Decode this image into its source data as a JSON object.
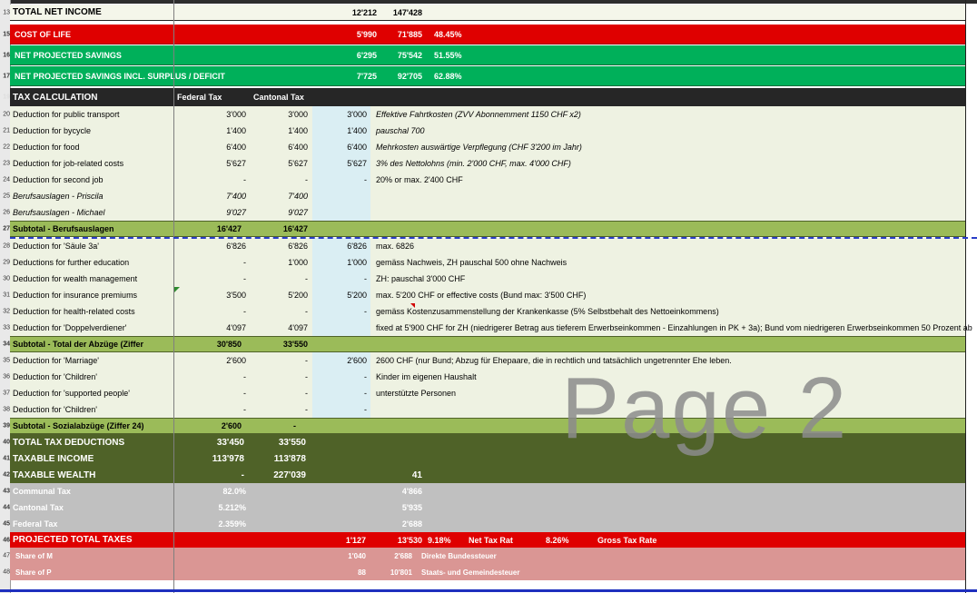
{
  "rows": {
    "r13": {
      "n": "13",
      "label": "TOTAL NET INCOME",
      "v1": "12'212",
      "v2": "147'428"
    },
    "r15": {
      "n": "15",
      "label": "COST OF LIFE",
      "v1": "5'990",
      "v2": "71'885",
      "v3": "48.45%"
    },
    "r16": {
      "n": "16",
      "label": "NET PROJECTED SAVINGS",
      "v1": "6'295",
      "v2": "75'542",
      "v3": "51.55%"
    },
    "r17": {
      "n": "17",
      "label": "NET PROJECTED SAVINGS INCL. SURPLUS / DEFICIT",
      "v1": "7'725",
      "v2": "92'705",
      "v3": "62.88%"
    },
    "r19": {
      "n": "19",
      "label": "TAX CALCULATION",
      "h1": "Federal Tax",
      "h2": "Cantonal Tax"
    },
    "r20": {
      "n": "20",
      "label": "Deduction for public transport",
      "f": "3'000",
      "k": "3'000",
      "b": "3'000",
      "note": "Effektive Fahrtkosten (ZVV Abonnemment 1150 CHF x2)"
    },
    "r21": {
      "n": "21",
      "label": "Deduction for bycycle",
      "f": "1'400",
      "k": "1'400",
      "b": "1'400",
      "note": "pauschal 700"
    },
    "r22": {
      "n": "22",
      "label": "Deduction for food",
      "f": "6'400",
      "k": "6'400",
      "b": "6'400",
      "note": "Mehrkosten auswärtige Verpflegung (CHF 3'200 im Jahr)"
    },
    "r23": {
      "n": "23",
      "label": "Deduction for job-related costs",
      "f": "5'627",
      "k": "5'627",
      "b": "5'627",
      "note": "3% des Nettolohns (min. 2'000 CHF, max. 4'000 CHF)"
    },
    "r24": {
      "n": "24",
      "label": "Deduction for second job",
      "f": "-",
      "k": "-",
      "b": "-",
      "note": "20% or max. 2'400 CHF"
    },
    "r25": {
      "n": "25",
      "label": "Berufsauslagen - Priscila",
      "f": "7'400",
      "k": "7'400"
    },
    "r26": {
      "n": "26",
      "label": "Berufsauslagen - Michael",
      "f": "9'027",
      "k": "9'027"
    },
    "r27": {
      "n": "27",
      "label": "Subtotal - Berufsauslagen",
      "f": "16'427",
      "k": "16'427"
    },
    "r28": {
      "n": "28",
      "label": "Deduction for 'Säule 3a'",
      "f": "6'826",
      "k": "6'826",
      "b": "6'826",
      "note": "max. 6826"
    },
    "r29": {
      "n": "29",
      "label": "Deductions for further education",
      "f": "-",
      "k": "1'000",
      "b": "1'000",
      "note": "gemäss Nachweis, ZH pauschal 500 ohne Nachweis"
    },
    "r30": {
      "n": "30",
      "label": "Deduction for wealth management",
      "f": "-",
      "k": "-",
      "b": "-",
      "note": "ZH: pauschal 3'000 CHF"
    },
    "r31": {
      "n": "31",
      "label": "Deduction for insurance premiums",
      "f": "3'500",
      "k": "5'200",
      "b": "5'200",
      "note": "max. 5'200 CHF or effective costs (Bund max: 3'500 CHF)"
    },
    "r32": {
      "n": "32",
      "label": "Deduction for health-related costs",
      "f": "-",
      "k": "-",
      "b": "-",
      "note": "gemäss Kostenzusammenstellung der Krankenkasse (5% Selbstbehalt des Nettoeinkommens)"
    },
    "r33": {
      "n": "33",
      "label": "Deduction for 'Doppelverdiener'",
      "f": "4'097",
      "k": "4'097",
      "note": "fixed at 5'900 CHF for ZH (niedrigerer Betrag aus tieferem Erwerbseinkommen - Einzahlungen in PK + 3a); Bund vom niedrigeren Erwerbseinkommen 50 Prozent ab"
    },
    "r34": {
      "n": "34",
      "label": "Subtotal - Total der Abzüge (Ziffer",
      "f": "30'850",
      "k": "33'550"
    },
    "r35": {
      "n": "35",
      "label": "Deduction for 'Marriage'",
      "f": "2'600",
      "k": "-",
      "b": "2'600",
      "note": "2600 CHF (nur Bund; Abzug für Ehepaare, die in rechtlich und tatsächlich ungetrennter Ehe leben."
    },
    "r36": {
      "n": "36",
      "label": "Deduction for 'Children'",
      "f": "-",
      "k": "-",
      "b": "-",
      "note": "Kinder im eigenen Haushalt"
    },
    "r37": {
      "n": "37",
      "label": "Deduction for 'supported people'",
      "f": "-",
      "k": "-",
      "b": "-",
      "note": "unterstützte Personen"
    },
    "r38": {
      "n": "38",
      "label": "Deduction for 'Children'",
      "f": "-",
      "k": "-",
      "b": "-"
    },
    "r39": {
      "n": "39",
      "label": "Subtotal - Sozialabzüge (Ziffer 24)",
      "f": "2'600",
      "k": "-"
    },
    "r40": {
      "n": "40",
      "label": "TOTAL TAX DEDUCTIONS",
      "f": "33'450",
      "k": "33'550"
    },
    "r41": {
      "n": "41",
      "label": "TAXABLE INCOME",
      "f": "113'978",
      "k": "113'878"
    },
    "r42": {
      "n": "42",
      "label": "TAXABLE WEALTH",
      "f": "-",
      "k": "227'039",
      "x": "41"
    },
    "r43": {
      "n": "43",
      "label": "Communal Tax",
      "f": "82.0%",
      "x": "4'866"
    },
    "r44": {
      "n": "44",
      "label": "Cantonal Tax",
      "f": "5.212%",
      "x": "5'935"
    },
    "r45": {
      "n": "45",
      "label": "Federal Tax",
      "f": "2.359%",
      "x": "2'688"
    },
    "r46": {
      "n": "46",
      "label": "PROJECTED TOTAL TAXES",
      "v1": "1'127",
      "v2": "13'530",
      "v3": "9.18%",
      "t1": "Net  Tax Rat",
      "v4": "8.26%",
      "t2": "Gross Tax Rate"
    },
    "r47": {
      "n": "47",
      "label": "Share of M",
      "v1": "1'040",
      "v2": "2'688",
      "t1": "Direkte Bundessteuer"
    },
    "r48": {
      "n": "48",
      "label": "Share of P",
      "v1": "88",
      "v2": "10'801",
      "t1": "Staats- und Gemeindesteuer"
    }
  },
  "watermark": "Page 2",
  "colors": {
    "red": "#df0000",
    "green": "#00b05a",
    "olive": "#9bbb59",
    "dark_olive": "#4f6228",
    "gray": "#c0c0c0",
    "pink": "#da9694",
    "blue_col": "#daeef3",
    "light": "#eef2e2"
  }
}
